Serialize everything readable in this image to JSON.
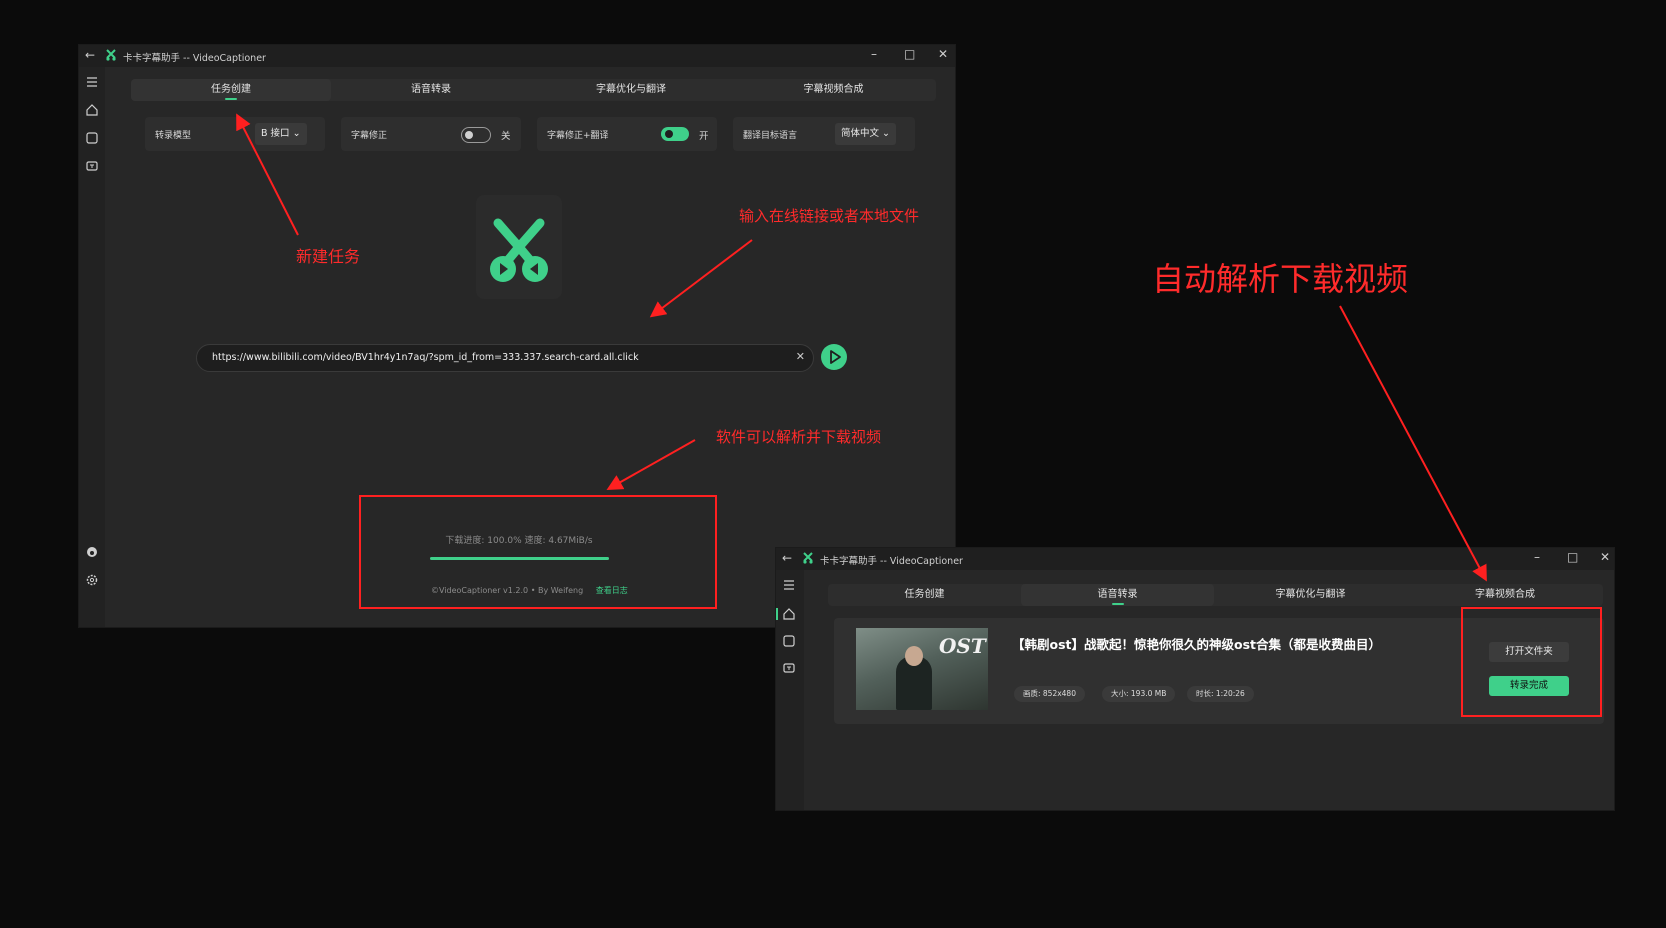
{
  "window1": {
    "title": "卡卡字幕助手 -- VideoCaptioner",
    "tabs": [
      "任务创建",
      "语音转录",
      "字幕优化与翻译",
      "字幕视频合成"
    ],
    "settings": {
      "model_label": "转录模型",
      "model_value": "B 接口",
      "fix_label": "字幕修正",
      "fix_state": "关",
      "fix_translate_label": "字幕修正+翻译",
      "fix_translate_state": "开",
      "target_lang_label": "翻译目标语言",
      "target_lang_value": "简体中文"
    },
    "url_value": "https://www.bilibili.com/video/BV1hr4y1n7aq/?spm_id_from=333.337.search-card.all.click",
    "progress_text": "下载进度: 100.0%  速度: 4.67MiB/s",
    "progress": 1.0,
    "footer_text": "©VideoCaptioner v1.2.0 • By Weifeng",
    "footer_link": "查看日志"
  },
  "window2": {
    "title": "卡卡字幕助手 -- VideoCaptioner",
    "tabs": [
      "任务创建",
      "语音转录",
      "字幕优化与翻译",
      "字幕视频合成"
    ],
    "video_title": "【韩剧ost】战歌起！惊艳你很久的神级ost合集（都是收费曲目）",
    "thumb_text": "OST",
    "tags": [
      "画质: 852x480",
      "大小: 193.0 MB",
      "时长: 1:20:26"
    ],
    "open_folder_label": "打开文件夹",
    "done_label": "转录完成"
  },
  "annotations": {
    "new_task": "新建任务",
    "input_hint": "输入在线链接或者本地文件",
    "parse_hint": "软件可以解析并下载视频",
    "auto_parse": "自动解析下载视频"
  },
  "colors": {
    "accent": "#3fd08a",
    "annotation": "#ff2b2b"
  }
}
